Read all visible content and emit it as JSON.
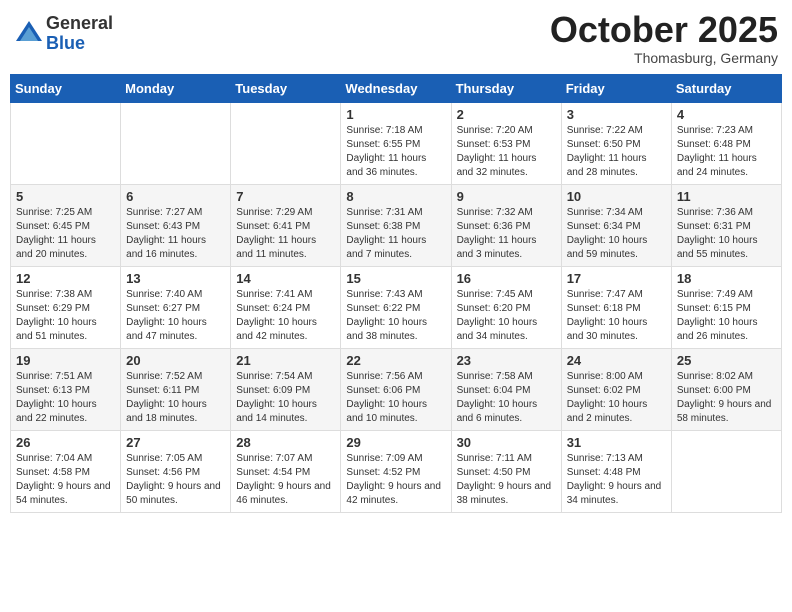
{
  "logo": {
    "general": "General",
    "blue": "Blue"
  },
  "title": "October 2025",
  "subtitle": "Thomasburg, Germany",
  "days_of_week": [
    "Sunday",
    "Monday",
    "Tuesday",
    "Wednesday",
    "Thursday",
    "Friday",
    "Saturday"
  ],
  "weeks": [
    [
      {
        "day": "",
        "info": ""
      },
      {
        "day": "",
        "info": ""
      },
      {
        "day": "",
        "info": ""
      },
      {
        "day": "1",
        "info": "Sunrise: 7:18 AM\nSunset: 6:55 PM\nDaylight: 11 hours and 36 minutes."
      },
      {
        "day": "2",
        "info": "Sunrise: 7:20 AM\nSunset: 6:53 PM\nDaylight: 11 hours and 32 minutes."
      },
      {
        "day": "3",
        "info": "Sunrise: 7:22 AM\nSunset: 6:50 PM\nDaylight: 11 hours and 28 minutes."
      },
      {
        "day": "4",
        "info": "Sunrise: 7:23 AM\nSunset: 6:48 PM\nDaylight: 11 hours and 24 minutes."
      }
    ],
    [
      {
        "day": "5",
        "info": "Sunrise: 7:25 AM\nSunset: 6:45 PM\nDaylight: 11 hours and 20 minutes."
      },
      {
        "day": "6",
        "info": "Sunrise: 7:27 AM\nSunset: 6:43 PM\nDaylight: 11 hours and 16 minutes."
      },
      {
        "day": "7",
        "info": "Sunrise: 7:29 AM\nSunset: 6:41 PM\nDaylight: 11 hours and 11 minutes."
      },
      {
        "day": "8",
        "info": "Sunrise: 7:31 AM\nSunset: 6:38 PM\nDaylight: 11 hours and 7 minutes."
      },
      {
        "day": "9",
        "info": "Sunrise: 7:32 AM\nSunset: 6:36 PM\nDaylight: 11 hours and 3 minutes."
      },
      {
        "day": "10",
        "info": "Sunrise: 7:34 AM\nSunset: 6:34 PM\nDaylight: 10 hours and 59 minutes."
      },
      {
        "day": "11",
        "info": "Sunrise: 7:36 AM\nSunset: 6:31 PM\nDaylight: 10 hours and 55 minutes."
      }
    ],
    [
      {
        "day": "12",
        "info": "Sunrise: 7:38 AM\nSunset: 6:29 PM\nDaylight: 10 hours and 51 minutes."
      },
      {
        "day": "13",
        "info": "Sunrise: 7:40 AM\nSunset: 6:27 PM\nDaylight: 10 hours and 47 minutes."
      },
      {
        "day": "14",
        "info": "Sunrise: 7:41 AM\nSunset: 6:24 PM\nDaylight: 10 hours and 42 minutes."
      },
      {
        "day": "15",
        "info": "Sunrise: 7:43 AM\nSunset: 6:22 PM\nDaylight: 10 hours and 38 minutes."
      },
      {
        "day": "16",
        "info": "Sunrise: 7:45 AM\nSunset: 6:20 PM\nDaylight: 10 hours and 34 minutes."
      },
      {
        "day": "17",
        "info": "Sunrise: 7:47 AM\nSunset: 6:18 PM\nDaylight: 10 hours and 30 minutes."
      },
      {
        "day": "18",
        "info": "Sunrise: 7:49 AM\nSunset: 6:15 PM\nDaylight: 10 hours and 26 minutes."
      }
    ],
    [
      {
        "day": "19",
        "info": "Sunrise: 7:51 AM\nSunset: 6:13 PM\nDaylight: 10 hours and 22 minutes."
      },
      {
        "day": "20",
        "info": "Sunrise: 7:52 AM\nSunset: 6:11 PM\nDaylight: 10 hours and 18 minutes."
      },
      {
        "day": "21",
        "info": "Sunrise: 7:54 AM\nSunset: 6:09 PM\nDaylight: 10 hours and 14 minutes."
      },
      {
        "day": "22",
        "info": "Sunrise: 7:56 AM\nSunset: 6:06 PM\nDaylight: 10 hours and 10 minutes."
      },
      {
        "day": "23",
        "info": "Sunrise: 7:58 AM\nSunset: 6:04 PM\nDaylight: 10 hours and 6 minutes."
      },
      {
        "day": "24",
        "info": "Sunrise: 8:00 AM\nSunset: 6:02 PM\nDaylight: 10 hours and 2 minutes."
      },
      {
        "day": "25",
        "info": "Sunrise: 8:02 AM\nSunset: 6:00 PM\nDaylight: 9 hours and 58 minutes."
      }
    ],
    [
      {
        "day": "26",
        "info": "Sunrise: 7:04 AM\nSunset: 4:58 PM\nDaylight: 9 hours and 54 minutes."
      },
      {
        "day": "27",
        "info": "Sunrise: 7:05 AM\nSunset: 4:56 PM\nDaylight: 9 hours and 50 minutes."
      },
      {
        "day": "28",
        "info": "Sunrise: 7:07 AM\nSunset: 4:54 PM\nDaylight: 9 hours and 46 minutes."
      },
      {
        "day": "29",
        "info": "Sunrise: 7:09 AM\nSunset: 4:52 PM\nDaylight: 9 hours and 42 minutes."
      },
      {
        "day": "30",
        "info": "Sunrise: 7:11 AM\nSunset: 4:50 PM\nDaylight: 9 hours and 38 minutes."
      },
      {
        "day": "31",
        "info": "Sunrise: 7:13 AM\nSunset: 4:48 PM\nDaylight: 9 hours and 34 minutes."
      },
      {
        "day": "",
        "info": ""
      }
    ]
  ]
}
